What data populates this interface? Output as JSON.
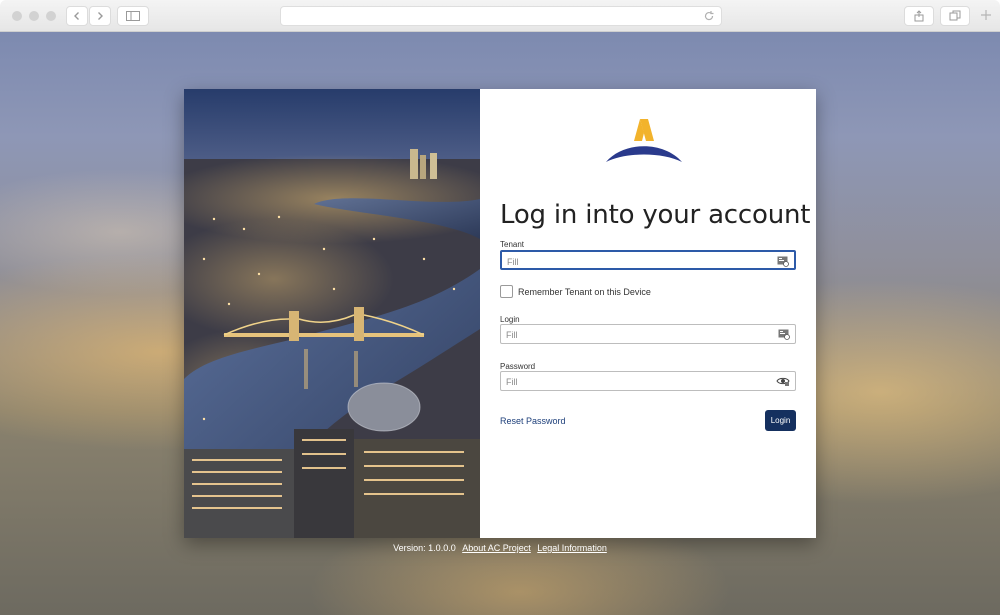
{
  "app": {
    "title": "Log in into your account"
  },
  "form": {
    "tenant_label": "Tenant",
    "tenant_placeholder": "Fill",
    "remember_label": "Remember Tenant on this Device",
    "login_label": "Login",
    "login_placeholder": "Fill",
    "password_label": "Password",
    "password_placeholder": "Fill",
    "reset_link": "Reset Password",
    "submit_label": "Login"
  },
  "footer": {
    "version": "Version: 1.0.0.0",
    "about_link": "About AC Project",
    "legal_link": "Legal Information"
  },
  "colors": {
    "accent": "#15305f",
    "logo_gold": "#f2b32c",
    "logo_blue": "#2a3a8c",
    "focus_border": "#2d5aa8"
  },
  "icons": {
    "tenant_field": "contact-card-icon",
    "login_field": "contact-card-icon",
    "password_field": "eye-icon"
  }
}
